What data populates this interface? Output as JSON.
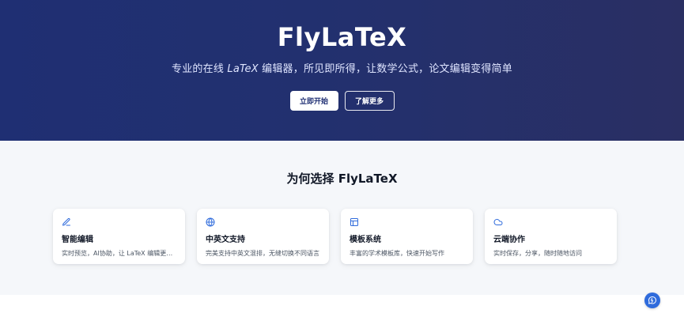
{
  "hero": {
    "title": "FlyLaTeX",
    "subtitle_prefix": "专业的在线 ",
    "subtitle_em": "LaTeX",
    "subtitle_suffix": " 编辑器，所见即所得，让数学公式，论文编辑变得简单",
    "primary_button": "立即开始",
    "secondary_button": "了解更多"
  },
  "features": {
    "title": "为何选择 FlyLaTeX",
    "cards": [
      {
        "icon": "pencil-icon",
        "title": "智能编辑",
        "desc": "实时预览，AI协助，让 LaTeX 编辑更轻松"
      },
      {
        "icon": "globe-icon",
        "title": "中英文支持",
        "desc": "完美支持中英文混排，无缝切换不同语言"
      },
      {
        "icon": "template-icon",
        "title": "模板系统",
        "desc": "丰富的学术模板库，快速开始写作"
      },
      {
        "icon": "cloud-icon",
        "title": "云端协作",
        "desc": "实时保存，分享，随时随地访问"
      }
    ]
  },
  "colors": {
    "hero_bg": "#1f2f73",
    "accent": "#2f6bdc",
    "section_bg": "#f5f7fa",
    "card_bg": "#ffffff"
  },
  "fab": {
    "icon": "chat-icon"
  }
}
